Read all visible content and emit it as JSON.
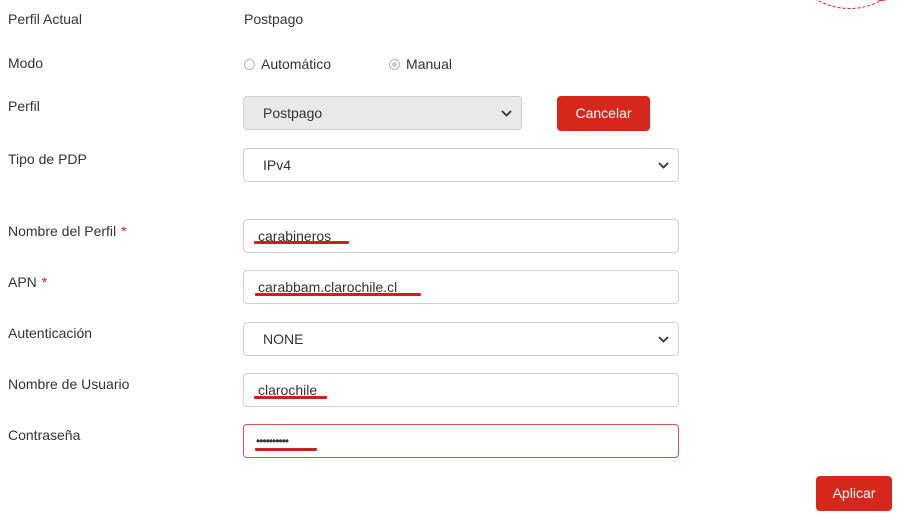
{
  "perfil_actual": {
    "label": "Perfil Actual",
    "value": "Postpago"
  },
  "modo": {
    "label": "Modo",
    "options": [
      {
        "label": "Automático",
        "checked": false
      },
      {
        "label": "Manual",
        "checked": true
      }
    ]
  },
  "perfil": {
    "label": "Perfil",
    "selected": "Postpago",
    "disabled": true
  },
  "cancel_label": "Cancelar",
  "tipo_pdp": {
    "label": "Tipo de PDP",
    "selected": "IPv4"
  },
  "nombre_perfil": {
    "label": "Nombre del Perfil",
    "required_mark": "*",
    "value": "carabineros"
  },
  "apn": {
    "label": "APN",
    "required_mark": "*",
    "value": "carabbam.clarochile.cl"
  },
  "autenticacion": {
    "label": "Autenticación",
    "selected": "NONE"
  },
  "usuario": {
    "label": "Nombre de Usuario",
    "value": "clarochile"
  },
  "contrasena": {
    "label": "Contraseña",
    "value": "••••••••••"
  },
  "apply_label": "Aplicar",
  "colors": {
    "accent": "#d7261b",
    "annotation": "#cc1f1f",
    "error_border": "#d9534f"
  },
  "icons": {
    "select_arrow": "chevron-down-icon",
    "logo": "logo-circle-icon"
  }
}
